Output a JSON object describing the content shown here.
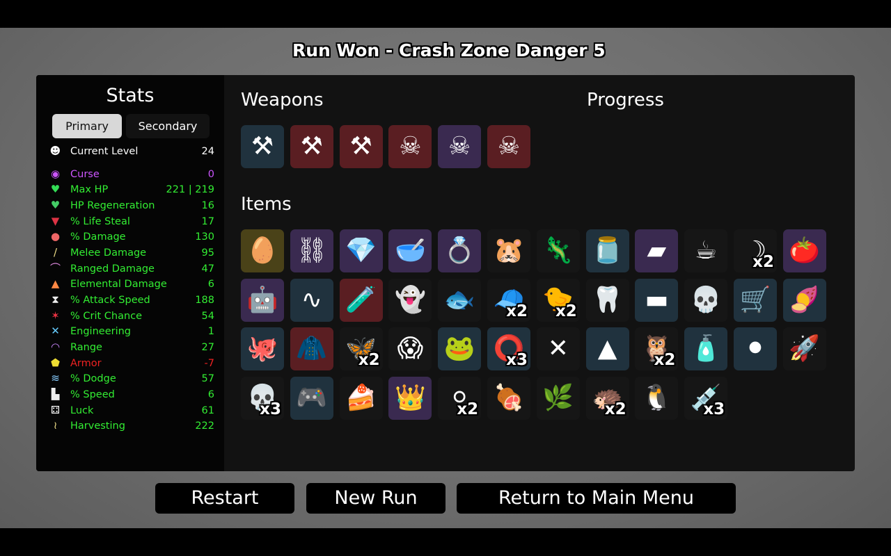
{
  "header": {
    "run_title": "Run Won - Crash Zone",
    "danger": "Danger 5"
  },
  "stats": {
    "title": "Stats",
    "tabs": [
      {
        "label": "Primary",
        "active": true
      },
      {
        "label": "Secondary",
        "active": false
      }
    ],
    "current_level": {
      "label": "Current Level",
      "value": "24",
      "icon": "level-face-icon",
      "color": "#ffffff"
    },
    "rows": [
      {
        "name": "curse",
        "label": "Curse",
        "value": "0",
        "icon": "curse-eye-icon",
        "glyph": "◉",
        "color": "#cc55ff",
        "icon_color": "#cc55ff"
      },
      {
        "name": "max-hp",
        "label": "Max HP",
        "value": "221 | 219",
        "icon": "heart-icon",
        "glyph": "♥",
        "color": "#33ee33",
        "icon_color": "#33dd55"
      },
      {
        "name": "hp-regeneration",
        "label": "HP Regeneration",
        "value": "16",
        "icon": "heart-plus-icon",
        "glyph": "♥",
        "color": "#33ee33",
        "icon_color": "#44cc66"
      },
      {
        "name": "life-steal",
        "label": "% Life Steal",
        "value": "17",
        "icon": "fangs-icon",
        "glyph": "▼",
        "color": "#33ee33",
        "icon_color": "#dd3344"
      },
      {
        "name": "damage",
        "label": "% Damage",
        "value": "130",
        "icon": "brain-icon",
        "glyph": "●",
        "color": "#33ee33",
        "icon_color": "#ee6666"
      },
      {
        "name": "melee-damage",
        "label": "Melee Damage",
        "value": "95",
        "icon": "sword-icon",
        "glyph": "/",
        "color": "#33ee33",
        "icon_color": "#eedd88"
      },
      {
        "name": "ranged-damage",
        "label": "Ranged Damage",
        "value": "47",
        "icon": "bow-icon",
        "glyph": "⌒",
        "color": "#33ee33",
        "icon_color": "#dd88dd"
      },
      {
        "name": "elemental-damage",
        "label": "Elemental Damage",
        "value": "6",
        "icon": "flame-icon",
        "glyph": "▲",
        "color": "#33ee33",
        "icon_color": "#ff8844"
      },
      {
        "name": "attack-speed",
        "label": "% Attack Speed",
        "value": "188",
        "icon": "hourglass-icon",
        "glyph": "⧗",
        "color": "#33ee33",
        "icon_color": "#eeeeee"
      },
      {
        "name": "crit-chance",
        "label": "% Crit Chance",
        "value": "54",
        "icon": "crit-burst-icon",
        "glyph": "✶",
        "color": "#33ee33",
        "icon_color": "#ee3344"
      },
      {
        "name": "engineering",
        "label": "Engineering",
        "value": "1",
        "icon": "wrench-cross-icon",
        "glyph": "✕",
        "color": "#33ee33",
        "icon_color": "#66ccff"
      },
      {
        "name": "range",
        "label": "Range",
        "value": "27",
        "icon": "range-waves-icon",
        "glyph": "◠",
        "color": "#33ee33",
        "icon_color": "#cc88ff"
      },
      {
        "name": "armor",
        "label": "Armor",
        "value": "-7",
        "icon": "shield-icon",
        "glyph": "⬟",
        "color": "#ee2222",
        "icon_color": "#eedd33"
      },
      {
        "name": "dodge",
        "label": "% Dodge",
        "value": "57",
        "icon": "dodge-wind-icon",
        "glyph": "≋",
        "color": "#33ee33",
        "icon_color": "#88ccff"
      },
      {
        "name": "speed",
        "label": "% Speed",
        "value": "6",
        "icon": "boot-icon",
        "glyph": "▙",
        "color": "#33ee33",
        "icon_color": "#eeeeee"
      },
      {
        "name": "luck",
        "label": "Luck",
        "value": "61",
        "icon": "dice-icon",
        "glyph": "⚃",
        "color": "#33ee33",
        "icon_color": "#ffffff"
      },
      {
        "name": "harvesting",
        "label": "Harvesting",
        "value": "222",
        "icon": "wheat-icon",
        "glyph": "≀",
        "color": "#33ee33",
        "icon_color": "#eedd88"
      }
    ]
  },
  "sections": {
    "weapons": "Weapons",
    "progress": "Progress",
    "items": "Items"
  },
  "tier_colors": {
    "tier1": "#20323e",
    "tier2": "#3a2a50",
    "tier3": "#5a1e22",
    "tier4": "#4a4218",
    "common": "#161616"
  },
  "weapons": [
    {
      "name": "axe",
      "icon": "axe-icon",
      "tier": "tier1",
      "glyph": "⚒"
    },
    {
      "name": "axe",
      "icon": "axe-icon",
      "tier": "tier3",
      "glyph": "⚒"
    },
    {
      "name": "axe",
      "icon": "axe-icon",
      "tier": "tier3",
      "glyph": "⚒"
    },
    {
      "name": "skull-hammer",
      "icon": "skull-hammer-icon",
      "tier": "tier3",
      "glyph": "☠"
    },
    {
      "name": "skull-hammer",
      "icon": "skull-hammer-icon",
      "tier": "tier2",
      "glyph": "☠"
    },
    {
      "name": "skull-hammer",
      "icon": "skull-hammer-icon",
      "tier": "tier3",
      "glyph": "☠"
    }
  ],
  "items": [
    {
      "icon": "egg-face-icon",
      "tier": "tier4",
      "glyph": "🥚",
      "qty": ""
    },
    {
      "icon": "handcuffs-icon",
      "tier": "tier2",
      "glyph": "⛓",
      "qty": ""
    },
    {
      "icon": "crystal-icon",
      "tier": "tier2",
      "glyph": "💎",
      "qty": ""
    },
    {
      "icon": "mortar-pestle-icon",
      "tier": "tier2",
      "glyph": "🥣",
      "qty": ""
    },
    {
      "icon": "ring-icon",
      "tier": "tier2",
      "glyph": "💍",
      "qty": ""
    },
    {
      "icon": "hamster-icon",
      "tier": "common",
      "glyph": "🐹",
      "qty": ""
    },
    {
      "icon": "lizard-icon",
      "tier": "common",
      "glyph": "🦎",
      "qty": ""
    },
    {
      "icon": "jar-icon",
      "tier": "tier1",
      "glyph": "🫙",
      "qty": ""
    },
    {
      "icon": "whetstone-icon",
      "tier": "tier2",
      "glyph": "▰",
      "qty": ""
    },
    {
      "icon": "coffee-cup-icon",
      "tier": "common",
      "glyph": "☕",
      "qty": ""
    },
    {
      "icon": "scythe-icon",
      "tier": "common",
      "glyph": "☽",
      "qty": "x2"
    },
    {
      "icon": "tomato-face-icon",
      "tier": "tier2",
      "glyph": "🍅",
      "qty": ""
    },
    {
      "icon": "robot-pod-icon",
      "tier": "tier2",
      "glyph": "🤖",
      "qty": ""
    },
    {
      "icon": "tentacle-icon",
      "tier": "tier1",
      "glyph": "∿",
      "qty": ""
    },
    {
      "icon": "blood-vial-icon",
      "tier": "tier3",
      "glyph": "🧪",
      "qty": ""
    },
    {
      "icon": "ghost-icon",
      "tier": "common",
      "glyph": "👻",
      "qty": ""
    },
    {
      "icon": "fish-icon",
      "tier": "common",
      "glyph": "🐟",
      "qty": ""
    },
    {
      "icon": "propeller-hat-icon",
      "tier": "common",
      "glyph": "🧢",
      "qty": "x2"
    },
    {
      "icon": "rubber-duck-icon",
      "tier": "common",
      "glyph": "🐤",
      "qty": "x2"
    },
    {
      "icon": "tooth-icon",
      "tier": "common",
      "glyph": "🦷",
      "qty": ""
    },
    {
      "icon": "cloth-icon",
      "tier": "tier1",
      "glyph": "▬",
      "qty": ""
    },
    {
      "icon": "animal-skull-icon",
      "tier": "common",
      "glyph": "💀",
      "qty": ""
    },
    {
      "icon": "wheelbarrow-icon",
      "tier": "tier1",
      "glyph": "🛒",
      "qty": ""
    },
    {
      "icon": "sweet-potato-icon",
      "tier": "tier1",
      "glyph": "🍠",
      "qty": ""
    },
    {
      "icon": "octopus-icon",
      "tier": "tier1",
      "glyph": "🐙",
      "qty": ""
    },
    {
      "icon": "red-cape-icon",
      "tier": "tier3",
      "glyph": "🧥",
      "qty": ""
    },
    {
      "icon": "butterfly-icon",
      "tier": "common",
      "glyph": "🦋",
      "qty": "x2"
    },
    {
      "icon": "screaming-mask-icon",
      "tier": "common",
      "glyph": "😱",
      "qty": ""
    },
    {
      "icon": "frog-icon",
      "tier": "tier1",
      "glyph": "🐸",
      "qty": ""
    },
    {
      "icon": "red-target-icon",
      "tier": "tier1",
      "glyph": "⭕",
      "qty": "x3"
    },
    {
      "icon": "thorn-icon",
      "tier": "common",
      "glyph": "✕",
      "qty": ""
    },
    {
      "icon": "bullet-icon",
      "tier": "tier1",
      "glyph": "▲",
      "qty": ""
    },
    {
      "icon": "owl-icon",
      "tier": "common",
      "glyph": "🦉",
      "qty": "x2"
    },
    {
      "icon": "hot-sauce-icon",
      "tier": "tier1",
      "glyph": "🧴",
      "qty": ""
    },
    {
      "icon": "goggles-icon",
      "tier": "tier1",
      "glyph": "⚫",
      "qty": ""
    },
    {
      "icon": "rocket-icon",
      "tier": "common",
      "glyph": "🚀",
      "qty": ""
    },
    {
      "icon": "red-eyed-skull-icon",
      "tier": "common",
      "glyph": "💀",
      "qty": "x3"
    },
    {
      "icon": "remote-control-icon",
      "tier": "tier1",
      "glyph": "🎮",
      "qty": ""
    },
    {
      "icon": "cake-icon",
      "tier": "common",
      "glyph": "🍰",
      "qty": ""
    },
    {
      "icon": "crown-icon",
      "tier": "tier2",
      "glyph": "👑",
      "qty": ""
    },
    {
      "icon": "snowball-icon",
      "tier": "common",
      "glyph": "⚪",
      "qty": "x2"
    },
    {
      "icon": "meat-skewer-icon",
      "tier": "common",
      "glyph": "🍖",
      "qty": ""
    },
    {
      "icon": "fertilizer-bag-icon",
      "tier": "common",
      "glyph": "🌿",
      "qty": ""
    },
    {
      "icon": "hedgehog-icon",
      "tier": "common",
      "glyph": "🦔",
      "qty": "x2"
    },
    {
      "icon": "penguin-icon",
      "tier": "common",
      "glyph": "🐧",
      "qty": ""
    },
    {
      "icon": "syringe-icon",
      "tier": "common",
      "glyph": "💉",
      "qty": "x3"
    }
  ],
  "buttons": {
    "restart": "Restart",
    "new_run": "New Run",
    "main_menu": "Return to Main Menu"
  }
}
